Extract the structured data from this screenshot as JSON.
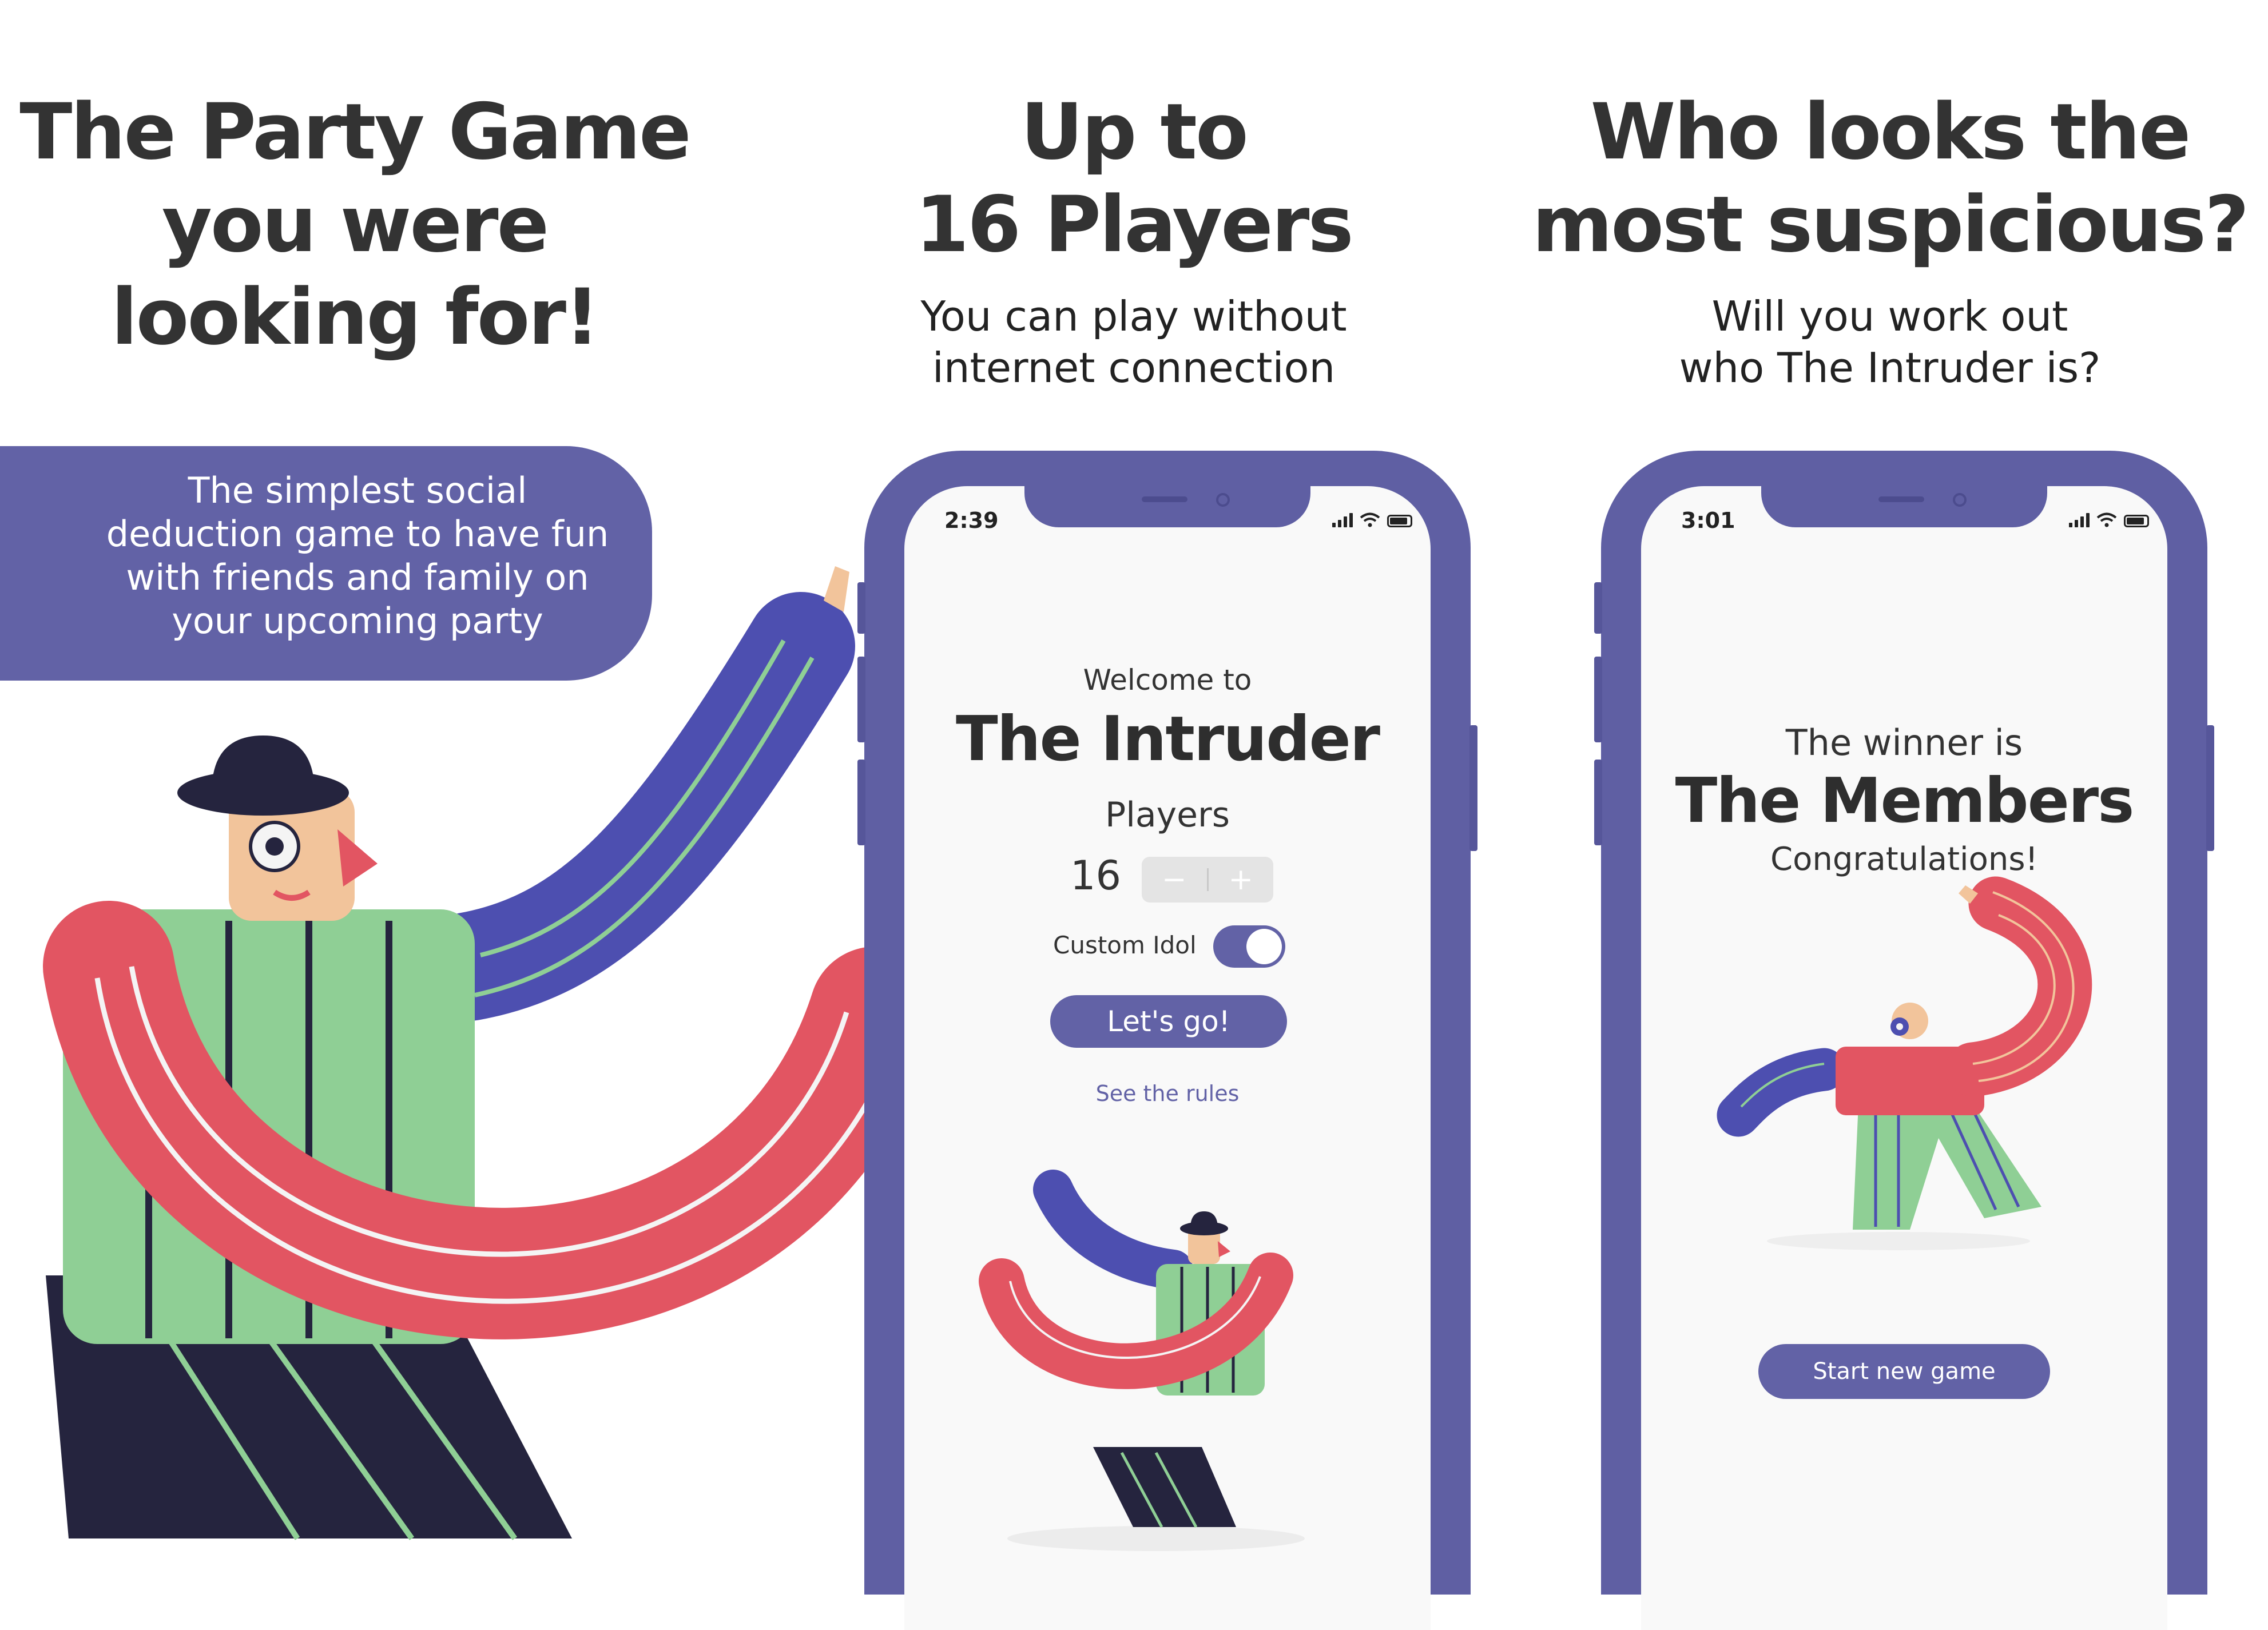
{
  "panel1": {
    "headline": [
      "The Party Game",
      "you were",
      "looking for!"
    ],
    "bubble": [
      "The simplest social",
      "deduction game to have fun",
      "with friends and family on",
      "your upcoming party"
    ]
  },
  "panel2": {
    "headline": [
      "Up to",
      "16 Players"
    ],
    "subline": [
      "You can play without",
      "internet connection"
    ],
    "phone": {
      "status_time": "2:39",
      "welcome": "Welcome to",
      "title": "The Intruder",
      "players_label": "Players",
      "players_count": "16",
      "minus": "−",
      "plus": "+",
      "custom_idol_label": "Custom Idol",
      "custom_idol_on": true,
      "go_button": "Let's go!",
      "rules_link": "See the rules"
    }
  },
  "panel3": {
    "headline": [
      "Who looks the",
      "most suspicious?"
    ],
    "subline": [
      "Will you work out",
      "who The Intruder is?"
    ],
    "phone": {
      "status_time": "3:01",
      "winner_label": "The winner is",
      "winner_team": "The Members",
      "congrats": "Congratulations!",
      "new_game_button": "Start new game"
    }
  },
  "colors": {
    "brand_purple": "#6262a6",
    "heading": "#333333",
    "figure_red": "#e25562",
    "figure_green": "#8fcf95",
    "figure_blue": "#4d4fb0",
    "figure_navy": "#25243e"
  }
}
